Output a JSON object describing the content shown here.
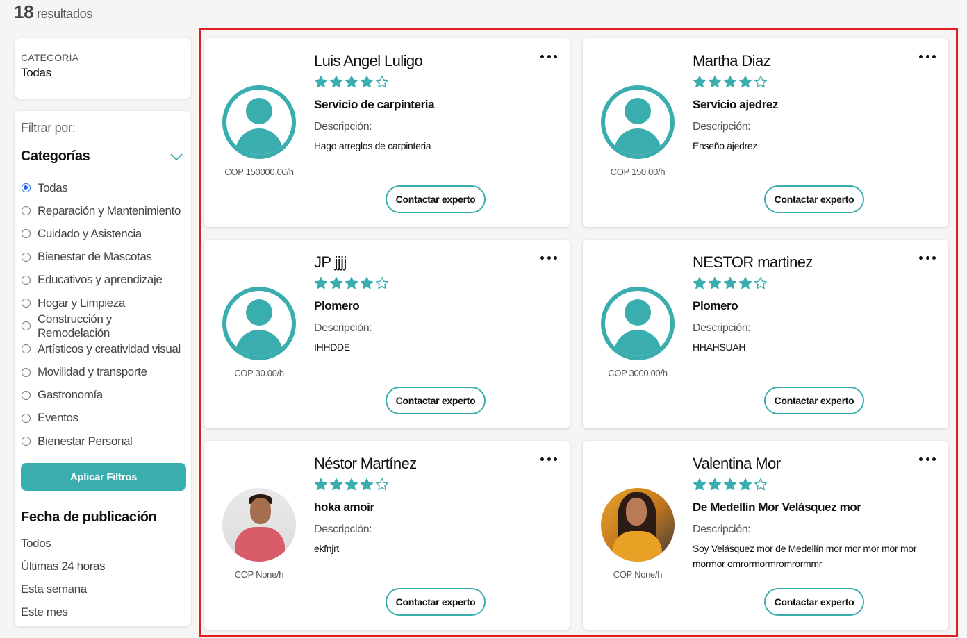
{
  "results": {
    "count": "18",
    "label": "resultados"
  },
  "category_box": {
    "label": "CATEGORÍA",
    "value": "Todas"
  },
  "filters": {
    "title": "Filtrar por:",
    "categories_title": "Categorías",
    "categories": [
      {
        "label": "Todas",
        "selected": true
      },
      {
        "label": "Reparación y Mantenimiento",
        "selected": false
      },
      {
        "label": "Cuidado y Asistencia",
        "selected": false
      },
      {
        "label": "Bienestar de Mascotas",
        "selected": false
      },
      {
        "label": "Educativos y aprendizaje",
        "selected": false
      },
      {
        "label": "Hogar y Limpieza",
        "selected": false
      },
      {
        "label": "Construcción y Remodelación",
        "selected": false
      },
      {
        "label": "Artísticos y creatividad visual",
        "selected": false
      },
      {
        "label": "Movilidad y transporte",
        "selected": false
      },
      {
        "label": "Gastronomía",
        "selected": false
      },
      {
        "label": "Eventos",
        "selected": false
      },
      {
        "label": "Bienestar Personal",
        "selected": false
      }
    ],
    "apply_label": "Aplicar Filtros",
    "date_title": "Fecha de publicación",
    "date_options": [
      "Todos",
      "Últimas 24 horas",
      "Esta semana",
      "Este mes"
    ]
  },
  "experts": [
    {
      "name": "Luis Angel Luligo",
      "rating": 4,
      "service": "Servicio de carpinteria",
      "desc_label": "Descripción:",
      "description": "Hago arreglos de carpinteria",
      "price": "COP 150000.00/h",
      "avatar": "default",
      "contact_label": "Contactar experto"
    },
    {
      "name": "Martha Diaz",
      "rating": 4,
      "service": "Servicio ajedrez",
      "desc_label": "Descripción:",
      "description": "Enseño ajedrez",
      "price": "COP 150.00/h",
      "avatar": "default",
      "contact_label": "Contactar experto"
    },
    {
      "name": "JP jjjj",
      "rating": 4,
      "service": "Plomero",
      "desc_label": "Descripción:",
      "description": "IHHDDE",
      "price": "COP 30.00/h",
      "avatar": "default",
      "contact_label": "Contactar experto"
    },
    {
      "name": "NESTOR martinez",
      "rating": 4,
      "service": "Plomero",
      "desc_label": "Descripción:",
      "description": "HHAHSUAH",
      "price": "COP 3000.00/h",
      "avatar": "default",
      "contact_label": "Contactar experto"
    },
    {
      "name": "Néstor Martínez",
      "rating": 4,
      "service": "hoka amoir",
      "desc_label": "Descripción:",
      "description": "ekfnjrt",
      "price": "COP None/h",
      "avatar": "photo1",
      "contact_label": "Contactar experto"
    },
    {
      "name": "Valentina Mor",
      "rating": 4,
      "service": "De Medellín Mor Velásquez mor",
      "desc_label": "Descripción:",
      "description": "Soy Velásquez mor de Medellín mor mor mor mor mor mormor omrormormromrormmr",
      "price": "COP None/h",
      "avatar": "photo2",
      "contact_label": "Contactar experto"
    }
  ],
  "colors": {
    "accent": "#3aaeaf",
    "highlight": "#e02020",
    "radio": "#1e6be0"
  },
  "icons": {
    "star": "star-icon",
    "more": "more-options-icon",
    "chevron": "chevron-down-icon",
    "avatar": "user-avatar-icon"
  }
}
